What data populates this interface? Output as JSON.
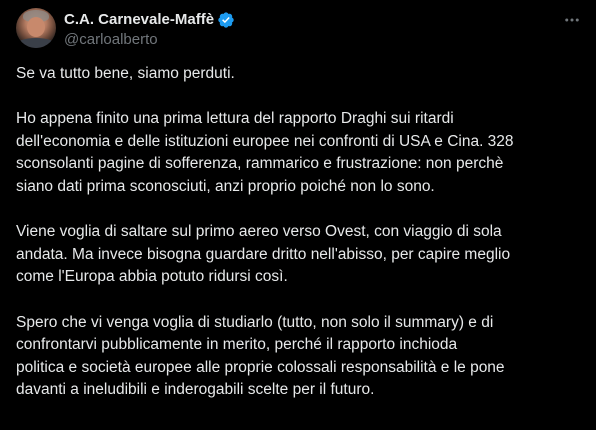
{
  "author": {
    "display_name": "C.A. Carnevale-Maffè",
    "handle": "@carloalberto",
    "verified": true,
    "verified_color": "#1d9bf0"
  },
  "actions": {
    "more_icon": "more-horizontal-icon"
  },
  "tweet": {
    "paragraphs": [
      "Se va tutto bene, siamo perduti.",
      "Ho appena finito una prima lettura del rapporto Draghi sui ritardi\ndell'economia e delle istituzioni europee nei confronti di USA e Cina. 328\nsconsolanti pagine di sofferenza, rammarico e frustrazione: non perchè\nsiano dati prima sconosciuti, anzi proprio poiché non lo sono.",
      "Viene voglia di saltare sul primo aereo verso Ovest, con viaggio di sola\nandata. Ma invece bisogna guardare dritto nell'abisso, per capire meglio\ncome l'Europa abbia potuto ridursi così.",
      "Spero che vi venga voglia di studiarlo (tutto, non solo il summary) e di\nconfrontarvi pubblicamente in merito, perché il rapporto inchioda\npolitica e società europee alle proprie colossali responsabilità e le pone\ndavanti a ineludibili e inderogabili scelte per il futuro."
    ]
  },
  "colors": {
    "background": "#000000",
    "text_primary": "#e7e9ea",
    "text_secondary": "#71767b"
  }
}
